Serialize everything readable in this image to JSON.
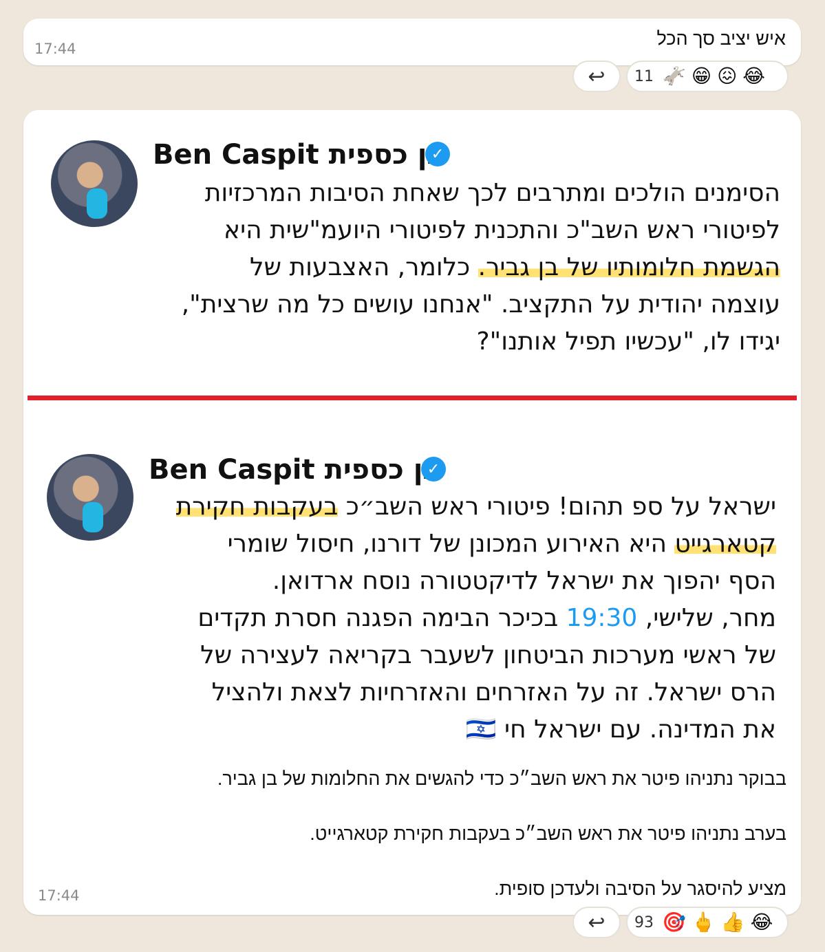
{
  "message1": {
    "text": "איש יציב סך הכל",
    "time": "17:44",
    "reactions": {
      "count": "11",
      "emojis": [
        "🫏",
        "😁",
        "😖",
        "😂"
      ]
    },
    "reply_icon": "reply-arrows-icon"
  },
  "message2": {
    "time": "17:44",
    "tweet1": {
      "name": "Ben Caspit בן כספית",
      "verified": "✓",
      "lines": [
        "הסימנים הולכים ומתרבים לכך שאחת הסיבות המרכזיות",
        "לפיטורי ראש השב\"כ והתכנית לפיטורי היועמ\"שית היא",
        "הגשמת חלומותיו של בן גביר. כלומר, האצבעות של",
        "עוצמה יהודית על התקציב. \"אנחנו עושים כל מה שרצית\",",
        "יגידו לו, \"עכשיו תפיל אותנו\"?"
      ],
      "highlight": "הגשמת חלומותיו של בן גביר."
    },
    "tweet2": {
      "name": "Ben Caspit בן כספית",
      "verified": "✓",
      "line1": "ישראל על ספ תהום! פיטורי ראש השב״כ בעקבות חקירת",
      "line2": "קטארגייט היא האירוע המכונן של דורנו, חיסול שומרי",
      "line3": "הסף יהפוך את ישראל לדיקטטורה נוסח ארדואן.",
      "line4_a": "מחר, שלישי,",
      "line4_time": "19:30",
      "line4_b": "בכיכר הבימה הפגנה חסרת תקדים",
      "line5": "של ראשי מערכות הביטחון לשעבר בקריאה לעצירה של",
      "line6": "הרס ישראל. זה על האזרחים והאזרחיות לצאת ולהציל",
      "line7": "את המדינה. עם ישראל חי 🇮🇱"
    },
    "caption_lines": [
      "בבוקר נתניהו פיטר את ראש השב״כ כדי להגשים את החלומות של בן גביר.",
      "בערב נתניהו פיטר את ראש השב״כ בעקבות חקירת קטארגייט.",
      "מציע להיסגר על הסיבה ולעדכן סופית."
    ],
    "reactions": {
      "count": "93",
      "emojis": [
        "🎯",
        "🖕",
        "👍",
        "😂"
      ]
    },
    "reply_icon": "reply-arrows-icon"
  },
  "colors": {
    "background": "#efe7dc",
    "divider": "#e0202a",
    "verified": "#1d9bf0",
    "highlight": "#ffd228"
  }
}
